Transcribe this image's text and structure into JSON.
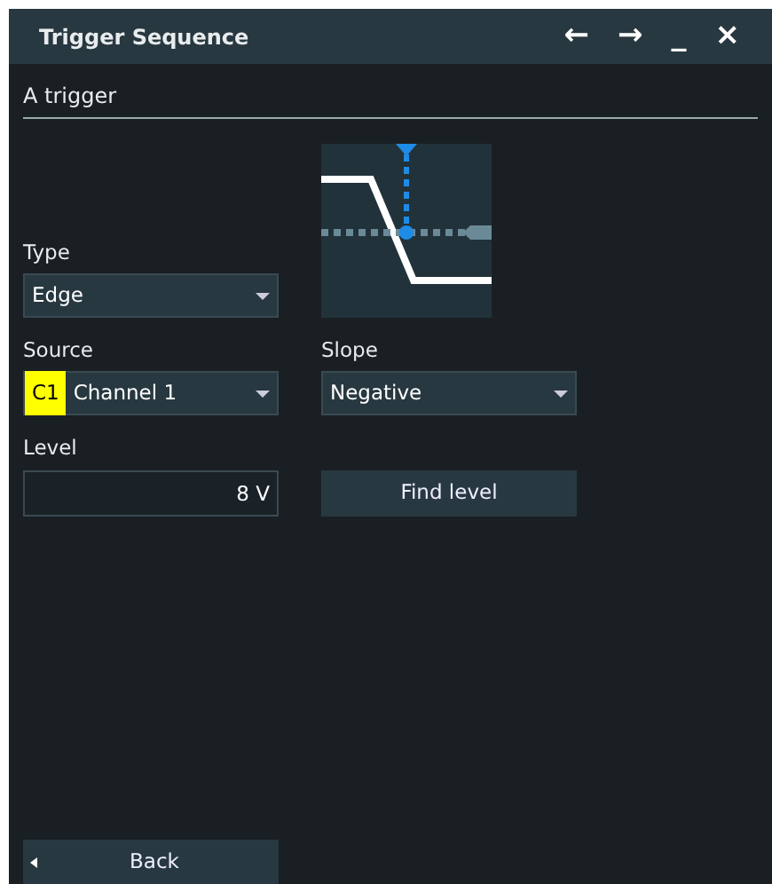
{
  "window": {
    "title": "Trigger Sequence",
    "controls": [
      "←",
      "→",
      "_",
      "×"
    ]
  },
  "section": {
    "title": "A trigger"
  },
  "type": {
    "label": "Type",
    "value": "Edge"
  },
  "source": {
    "label": "Source",
    "badge": "C1",
    "color": "#ffff00",
    "value": "Channel 1"
  },
  "slope": {
    "label": "Slope",
    "value": "Negative"
  },
  "level": {
    "label": "Level",
    "value": "8 V"
  },
  "find_level_button": "Find level",
  "back_button": "Back"
}
